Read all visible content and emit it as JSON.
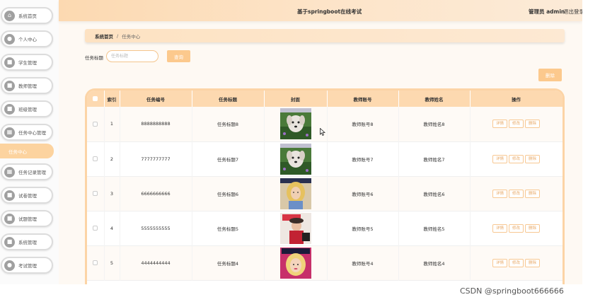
{
  "header": {
    "title": "基于springboot在线考试",
    "user": "管理员 admin",
    "logout": "退出登录"
  },
  "sidebar": {
    "items": [
      {
        "label": "系统首页",
        "icon": "home-icon",
        "glyph": "⌂"
      },
      {
        "label": "个人中心",
        "icon": "user-icon",
        "glyph": "●"
      },
      {
        "label": "学生管理",
        "icon": "student-icon",
        "glyph": "■"
      },
      {
        "label": "教师管理",
        "icon": "teacher-icon",
        "glyph": "■"
      },
      {
        "label": "班级管理",
        "icon": "class-icon",
        "glyph": "■"
      },
      {
        "label": "任务中心管理",
        "icon": "grid-icon",
        "glyph": "▦"
      },
      {
        "label": "任务记录管理",
        "icon": "grid-icon",
        "glyph": "▦"
      },
      {
        "label": "试卷管理",
        "icon": "paper-icon",
        "glyph": "■"
      },
      {
        "label": "试题管理",
        "icon": "question-icon",
        "glyph": "■"
      },
      {
        "label": "系统管理",
        "icon": "settings-icon",
        "glyph": "■"
      },
      {
        "label": "考试管理",
        "icon": "exam-icon",
        "glyph": "●"
      }
    ],
    "active_sub": "任务中心"
  },
  "breadcrumb": {
    "home": "系统首页",
    "separator": "/",
    "current": "任务中心"
  },
  "search": {
    "label": "任务标题",
    "placeholder": "任务标题",
    "button": "查询"
  },
  "toolbar": {
    "delete_label": "删除"
  },
  "table": {
    "columns": [
      "索引",
      "任务编号",
      "任务标题",
      "封面",
      "教师账号",
      "教师姓名",
      "操作"
    ],
    "rows": [
      {
        "index": "1",
        "code": "8888888888",
        "title": "任务标题8",
        "account": "教师账号8",
        "name": "教师姓名8",
        "cover": "dog"
      },
      {
        "index": "2",
        "code": "7777777777",
        "title": "任务标题7",
        "account": "教师账号7",
        "name": "教师姓名7",
        "cover": "dog"
      },
      {
        "index": "3",
        "code": "6666666666",
        "title": "任务标题6",
        "account": "教师账号6",
        "name": "教师姓名6",
        "cover": "blonde"
      },
      {
        "index": "4",
        "code": "5555555555",
        "title": "任务标题5",
        "account": "教师账号5",
        "name": "教师姓名5",
        "cover": "style"
      },
      {
        "index": "5",
        "code": "4444444444",
        "title": "任务标题4",
        "account": "教师账号4",
        "name": "教师姓名4",
        "cover": "blonde2"
      }
    ],
    "actions": {
      "detail": "详情",
      "edit": "修改",
      "delete": "删除"
    }
  },
  "watermark": "CSDN @springboot666666",
  "colors": {
    "accent": "#fcc98d",
    "header": "#fdd9b0",
    "sidebar_active": "#fcd39f"
  }
}
